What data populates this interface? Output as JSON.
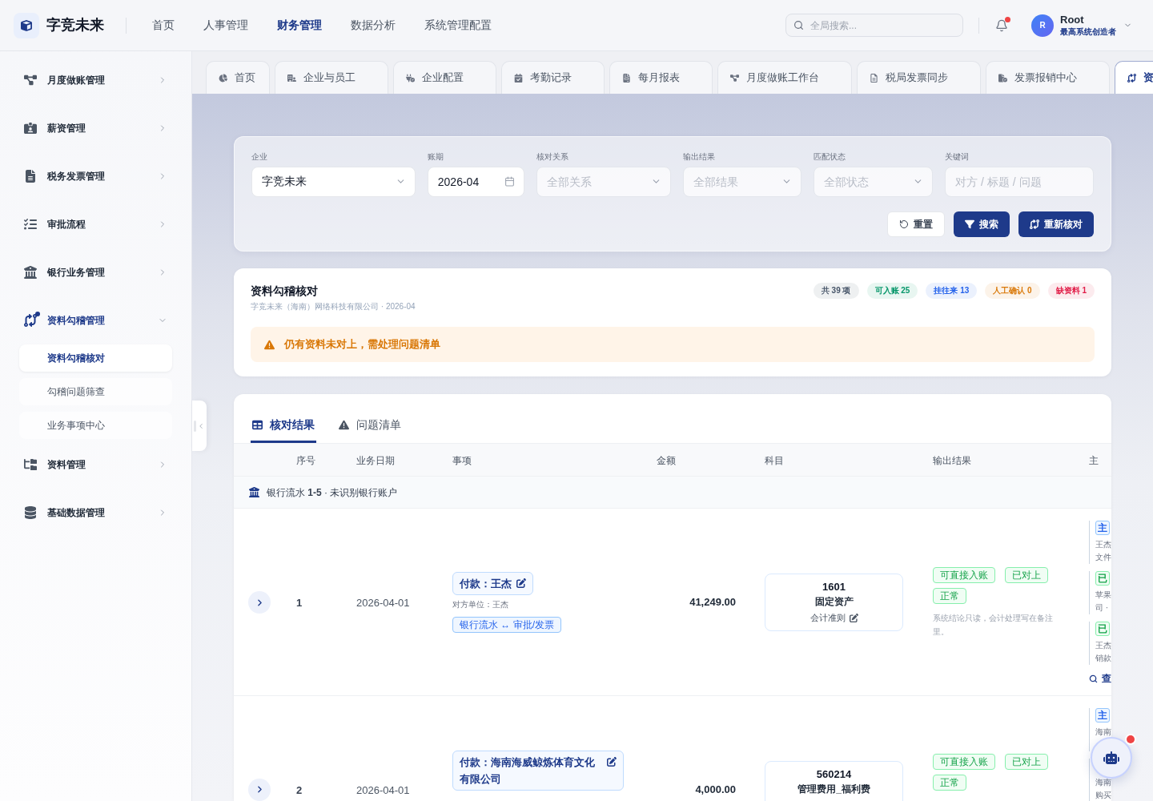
{
  "header": {
    "logo_text": "字竞未来",
    "nav": [
      {
        "label": "首页",
        "selected": false
      },
      {
        "label": "人事管理",
        "selected": false
      },
      {
        "label": "财务管理",
        "selected": true
      },
      {
        "label": "数据分析",
        "selected": false
      },
      {
        "label": "系统管理配置",
        "selected": false
      }
    ],
    "search": {
      "placeholder": "全局搜索..."
    },
    "notifications": {
      "unread": true
    },
    "user": {
      "avatar_letter": "R",
      "name": "Root",
      "role": "最高系统创造者"
    }
  },
  "sidebar": {
    "items": [
      {
        "label": "月度做账管理",
        "selected": false,
        "expanded": false,
        "badge_dot": false
      },
      {
        "label": "薪资管理",
        "selected": false,
        "expanded": false,
        "badge_dot": false
      },
      {
        "label": "税务发票管理",
        "selected": false,
        "expanded": false,
        "badge_dot": false
      },
      {
        "label": "审批流程",
        "selected": false,
        "expanded": false,
        "badge_dot": false
      },
      {
        "label": "银行业务管理",
        "selected": false,
        "expanded": false,
        "badge_dot": false
      },
      {
        "label": "资料勾稽管理",
        "selected": true,
        "expanded": true,
        "badge_dot": true,
        "children": [
          {
            "label": "资料勾稽核对",
            "selected": true
          },
          {
            "label": "勾稽问题筛查",
            "selected": false
          },
          {
            "label": "业务事项中心",
            "selected": false
          }
        ]
      },
      {
        "label": "资料管理",
        "selected": false,
        "expanded": false,
        "badge_dot": false
      },
      {
        "label": "基础数据管理",
        "selected": false,
        "expanded": false,
        "badge_dot": false
      }
    ]
  },
  "tabs": [
    {
      "label": "首页",
      "selected": false
    },
    {
      "label": "企业与员工",
      "selected": false
    },
    {
      "label": "企业配置",
      "selected": false
    },
    {
      "label": "考勤记录",
      "selected": false
    },
    {
      "label": "每月报表",
      "selected": false
    },
    {
      "label": "月度做账工作台",
      "selected": false
    },
    {
      "label": "税局发票同步",
      "selected": false
    },
    {
      "label": "发票报销中心",
      "selected": false
    },
    {
      "label": "资",
      "selected": true
    }
  ],
  "filters": {
    "fields": [
      {
        "label": "企业",
        "kind": "select",
        "value": "字竞未来"
      },
      {
        "label": "账期",
        "kind": "date",
        "value": "2026-04"
      },
      {
        "label": "核对关系",
        "kind": "select",
        "placeholder": "全部关系"
      },
      {
        "label": "输出结果",
        "kind": "select",
        "placeholder": "全部结果"
      },
      {
        "label": "匹配状态",
        "kind": "select",
        "placeholder": "全部状态"
      },
      {
        "label": "关键词",
        "kind": "text",
        "placeholder": "对方 / 标题 / 问题"
      }
    ],
    "buttons": [
      {
        "label": "重置",
        "kind": "secondary"
      },
      {
        "label": "搜索",
        "kind": "primary"
      },
      {
        "label": "重新核对",
        "kind": "primary"
      }
    ]
  },
  "summary": {
    "title": "资料勾稽核对",
    "subtitle": "字竞未来（海南）网络科技有限公司 · 2026-04",
    "counts": [
      {
        "label": "共 39 项",
        "color": "#475569"
      },
      {
        "label": "可入账 25",
        "color": "#059669"
      },
      {
        "label": "挂往来 13",
        "color": "#2563eb"
      },
      {
        "label": "人工确认 0",
        "color": "#d97706"
      },
      {
        "label": "缺资料 1",
        "color": "#e11d48"
      }
    ],
    "alert": "仍有资料未对上，需处理问题清单"
  },
  "results": {
    "tabs": [
      {
        "label": "核对结果",
        "selected": true
      },
      {
        "label": "问题清单",
        "selected": false
      }
    ],
    "columns": [
      "序号",
      "业务日期",
      "事项",
      "金额",
      "科目",
      "输出结果",
      "主"
    ],
    "groups": [
      {
        "title": "银行流水 **1-5** · 未识别银行账户",
        "rows": [
          {
            "index": "1",
            "date": "2026-04-01",
            "expanded": false,
            "item": {
              "title": "付款：王杰",
              "counterparty": "对方单位：王杰",
              "relation": "银行流水 ↔ 审批/发票"
            },
            "amount": "41,249.00",
            "subject": {
              "code": "1601",
              "name": "固定资产",
              "standard": "会计准则"
            },
            "output": {
              "tags": [
                "可直接入账",
                "已对上",
                "正常"
              ],
              "note": "系统结论只读，会计处理写在备注里。"
            },
            "main_docs": [
              {
                "tag": "主",
                "kind": "primary",
                "lines": [
                  "王杰",
                  "文件"
                ]
              },
              {
                "tag": "已",
                "kind": "matched",
                "lines": [
                  "苹果",
                  "司 ·"
                ]
              },
              {
                "tag": "已",
                "kind": "matched",
                "lines": [
                  "王杰",
                  "销款"
                ]
              }
            ],
            "main_docs_link": "查"
          },
          {
            "index": "2",
            "date": "2026-04-01",
            "expanded": false,
            "item": {
              "title": "付款：海南海威鲸炼体育文化有限公司"
            },
            "amount": "4,000.00",
            "subject": {
              "code": "560214",
              "name": "管理费用_福利费"
            },
            "output": {
              "tags": [
                "可直接入账",
                "已对上",
                "正常"
              ]
            },
            "main_docs": [
              {
                "tag": "主",
                "kind": "primary",
                "lines": [
                  "海南"
                ]
              },
              {
                "lines": [
                  "海南",
                  "购买"
                ]
              }
            ]
          }
        ]
      }
    ]
  },
  "assistant": {
    "unread": true
  }
}
